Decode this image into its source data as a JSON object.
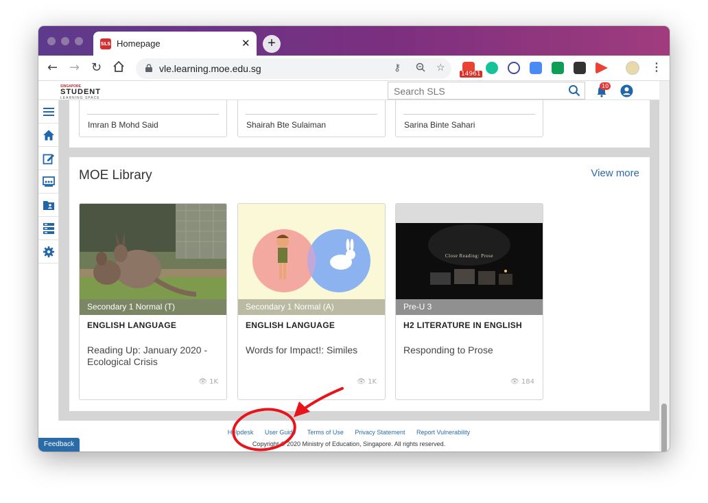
{
  "browser": {
    "tab_title": "Homepage",
    "tab_favicon_text": "SLS",
    "tab_close": "✕",
    "new_tab": "+",
    "url": "vle.learning.moe.edu.sg",
    "extension_badge": "14961"
  },
  "header": {
    "logo_small": "SINGAPORE",
    "logo_main": "STUDENT",
    "logo_sub": "LEARNING SPACE",
    "search_placeholder": "Search SLS",
    "notifications_count": "10"
  },
  "teachers": [
    {
      "name": "Imran B Mohd Said"
    },
    {
      "name": "Shairah Bte Sulaiman"
    },
    {
      "name": "Sarina Binte Sahari"
    }
  ],
  "library": {
    "title": "MOE Library",
    "view_more": "View more",
    "cards": [
      {
        "level": "Secondary 1 Normal (T)",
        "subject": "ENGLISH LANGUAGE",
        "title": "Reading Up: January 2020 - Ecological Crisis",
        "views": "1K"
      },
      {
        "level": "Secondary 1 Normal (A)",
        "subject": "ENGLISH LANGUAGE",
        "title": "Words for Impact!: Similes",
        "views": "1K"
      },
      {
        "level": "Pre-U 3",
        "subject": "H2 LITERATURE IN ENGLISH",
        "title": "Responding to Prose",
        "views": "184",
        "thumb_text": "Close Reading: Prose"
      }
    ]
  },
  "footer": {
    "links": [
      "Helpdesk",
      "User Guide",
      "Terms of Use",
      "Privacy Statement",
      "Report Vulnerability"
    ],
    "copyright": "Copyright © 2020 Ministry of Education, Singapore. All rights reserved.",
    "feedback": "Feedback"
  },
  "colors": {
    "titlebar_start": "#5e3a8c",
    "titlebar_end": "#a03c7e",
    "link_blue": "#2a6ba8",
    "sidebar_icon": "#2266aa",
    "annotation_red": "#e8141b"
  }
}
